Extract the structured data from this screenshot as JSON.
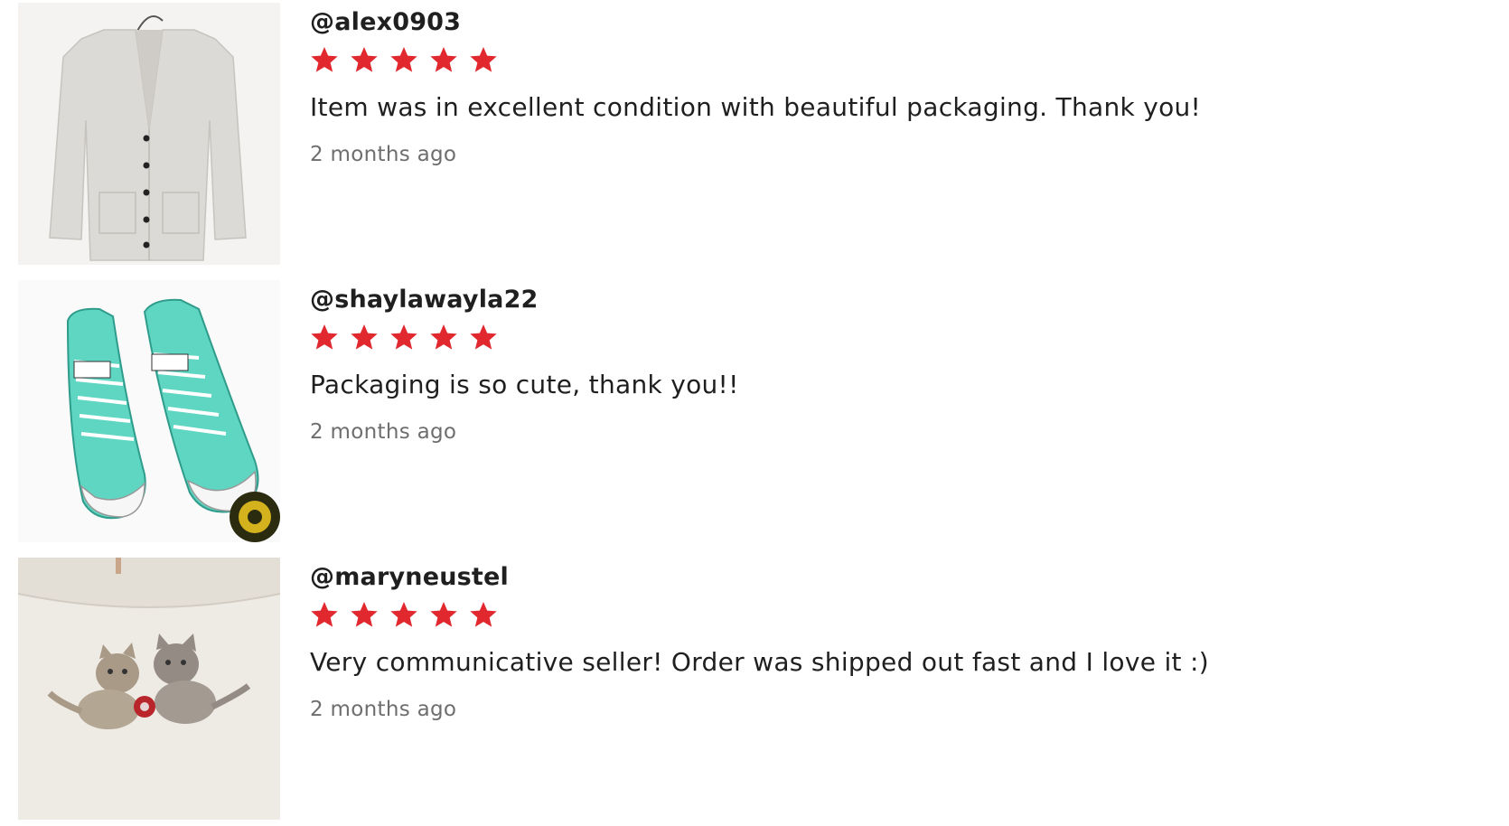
{
  "colors": {
    "star": "#e0282e",
    "username": "#1f1f1f",
    "comment": "#1f1f1f",
    "timestamp": "#6e6e6e"
  },
  "reviews": [
    {
      "username": "@alex0903",
      "rating": 5,
      "comment": "Item was in excellent condition with beautiful packaging. Thank you!",
      "time": "2 months ago",
      "thumbnail": "cardigan-photo"
    },
    {
      "username": "@shaylawayla22",
      "rating": 5,
      "comment": "Packaging is so cute, thank you!!",
      "time": "2 months ago",
      "thumbnail": "sneakers-photo"
    },
    {
      "username": "@maryneustel",
      "rating": 5,
      "comment": "Very communicative seller! Order was shipped out fast and I love it :)",
      "time": "2 months ago",
      "thumbnail": "kittens-shirt-photo"
    }
  ]
}
